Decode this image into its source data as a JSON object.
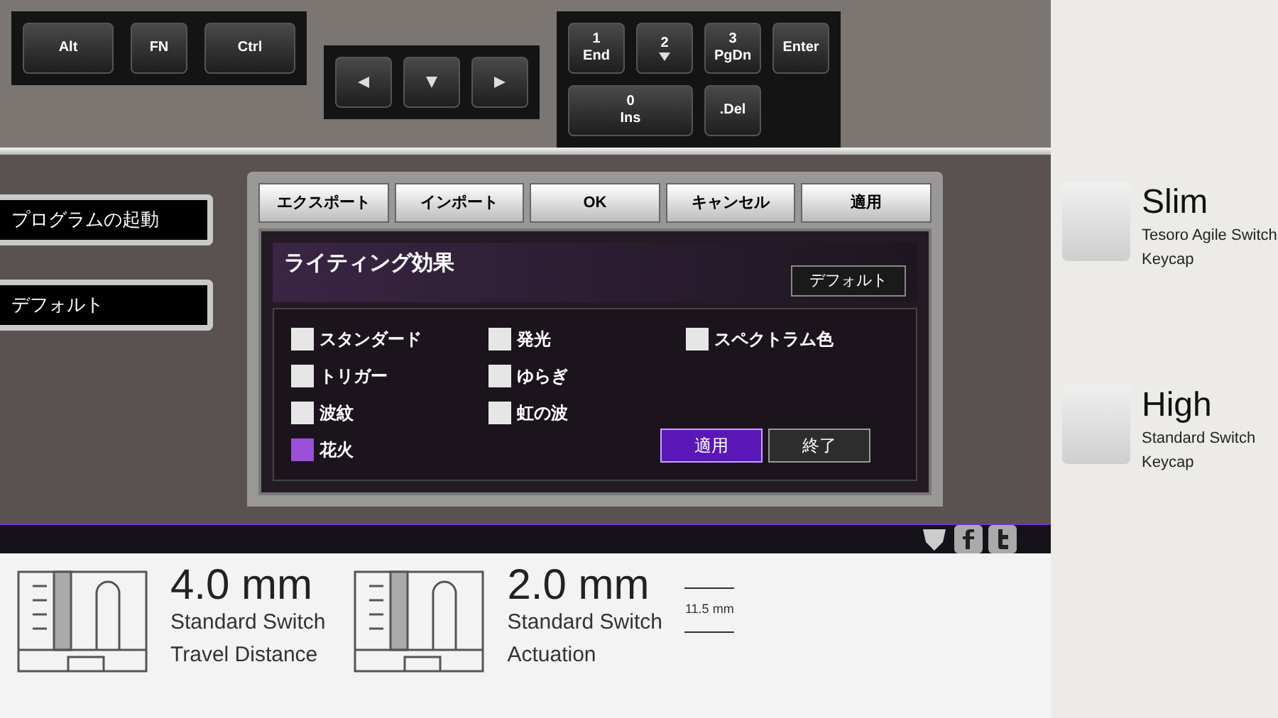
{
  "keyboard": {
    "keys": [
      {
        "label": "Alt"
      },
      {
        "label": "FN"
      },
      {
        "label": "Ctrl"
      }
    ],
    "numpad": [
      {
        "label": "1",
        "sub": "End"
      },
      {
        "label": "2"
      },
      {
        "label": "3",
        "sub": "PgDn"
      },
      {
        "label": "Enter"
      },
      {
        "label": "0",
        "sub": "Ins"
      },
      {
        "label": ".Del"
      }
    ]
  },
  "side_buttons": [
    "プログラムの起動",
    "デフォルト"
  ],
  "tabs": [
    "エクスポート",
    "インポート",
    "OK",
    "キャンセル",
    "適用"
  ],
  "lighting_panel": {
    "title": "ライティング効果",
    "default_button": "デフォルト",
    "columns": [
      [
        {
          "label": "スタンダード",
          "checked": false
        },
        {
          "label": "トリガー",
          "checked": false
        },
        {
          "label": "波紋",
          "checked": false
        },
        {
          "label": "花火",
          "checked": true
        }
      ],
      [
        {
          "label": "発光",
          "checked": false
        },
        {
          "label": "ゆらぎ",
          "checked": false
        },
        {
          "label": "虹の波",
          "checked": false
        }
      ],
      [
        {
          "label": "スペクトラム色",
          "checked": false
        }
      ]
    ],
    "buttons": [
      {
        "label": "適用",
        "kind": "primary"
      },
      {
        "label": "終了",
        "kind": "secondary"
      }
    ]
  },
  "specs": [
    {
      "value": "4.0 mm",
      "line1": "Standard Switch",
      "line2": "Travel Distance"
    },
    {
      "value": "2.0 mm",
      "line1": "Standard Switch",
      "line2": "Actuation"
    }
  ],
  "dimension": "11.5 mm",
  "keycaps": [
    {
      "title": "Slim",
      "line1": "Tesoro Agile Switch",
      "line2": "Keycap"
    },
    {
      "title": "High",
      "line1": "Standard Switch",
      "line2": "Keycap"
    }
  ]
}
